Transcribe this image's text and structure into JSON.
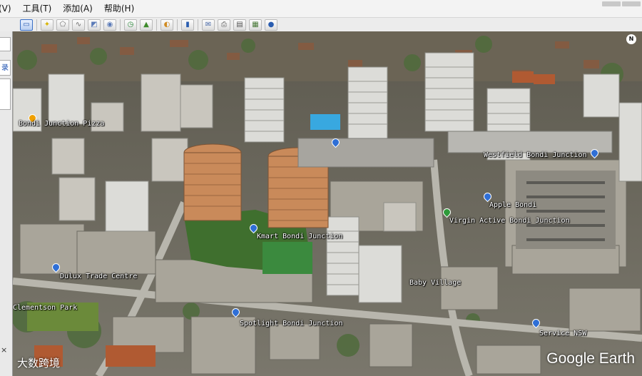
{
  "menu": {
    "items": [
      "(V)",
      "工具(T)",
      "添加(A)",
      "帮助(H)"
    ]
  },
  "toolbar": {
    "icons": [
      "sidebar-toggle-icon",
      "placemark-icon",
      "polygon-icon",
      "path-icon",
      "image-overlay-icon",
      "tour-icon",
      "historical-imagery-icon",
      "sunlight-icon",
      "planets-icon",
      "ruler-icon",
      "email-icon",
      "print-icon",
      "save-image-icon",
      "maps-icon",
      "earth-icon"
    ]
  },
  "sidebar": {
    "tab_label": "录",
    "close_glyph": "×"
  },
  "map": {
    "places": [
      {
        "name": "Bondi Junction Pizza",
        "kind": "food"
      },
      {
        "name": "Westfield Bondi Junction",
        "kind": "shop"
      },
      {
        "name": "Kmart Bondi Junction",
        "kind": "shop"
      },
      {
        "name": "Virgin Active Bondi Junction",
        "kind": "gym"
      },
      {
        "name": "Dulux Trade Centre",
        "kind": "shop"
      },
      {
        "name": "Clementson Park",
        "kind": "park"
      },
      {
        "name": "Spotlight Bondi Junction",
        "kind": "shop"
      },
      {
        "name": "Baby Village",
        "kind": "shop"
      },
      {
        "name": "Service NSW",
        "kind": "service"
      },
      {
        "name": "Apple Bondi",
        "kind": "shop"
      }
    ],
    "compass_label": "N",
    "logo_text": "Google Earth",
    "watermark_text": "大数跨境"
  },
  "colors": {
    "pin_shop": "#2f6fd6",
    "pin_food": "#f0a000",
    "pin_gym": "#2e9a3a",
    "toolbar_bg": "#ececec"
  }
}
